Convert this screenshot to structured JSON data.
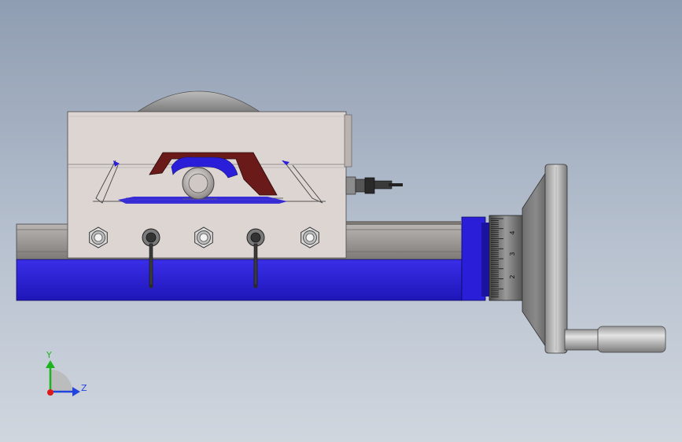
{
  "triad": {
    "y_label": "Y",
    "z_label": "Z",
    "y_color": "#1db31d",
    "z_color": "#2244dd",
    "x_color": "#dd1a1a"
  },
  "dial": {
    "numbers": [
      "4",
      "3",
      "2"
    ]
  },
  "colors": {
    "base_blue": "#2a1ed8",
    "block_gray": "#ddd5d2",
    "section_red": "#6b1a1a"
  }
}
